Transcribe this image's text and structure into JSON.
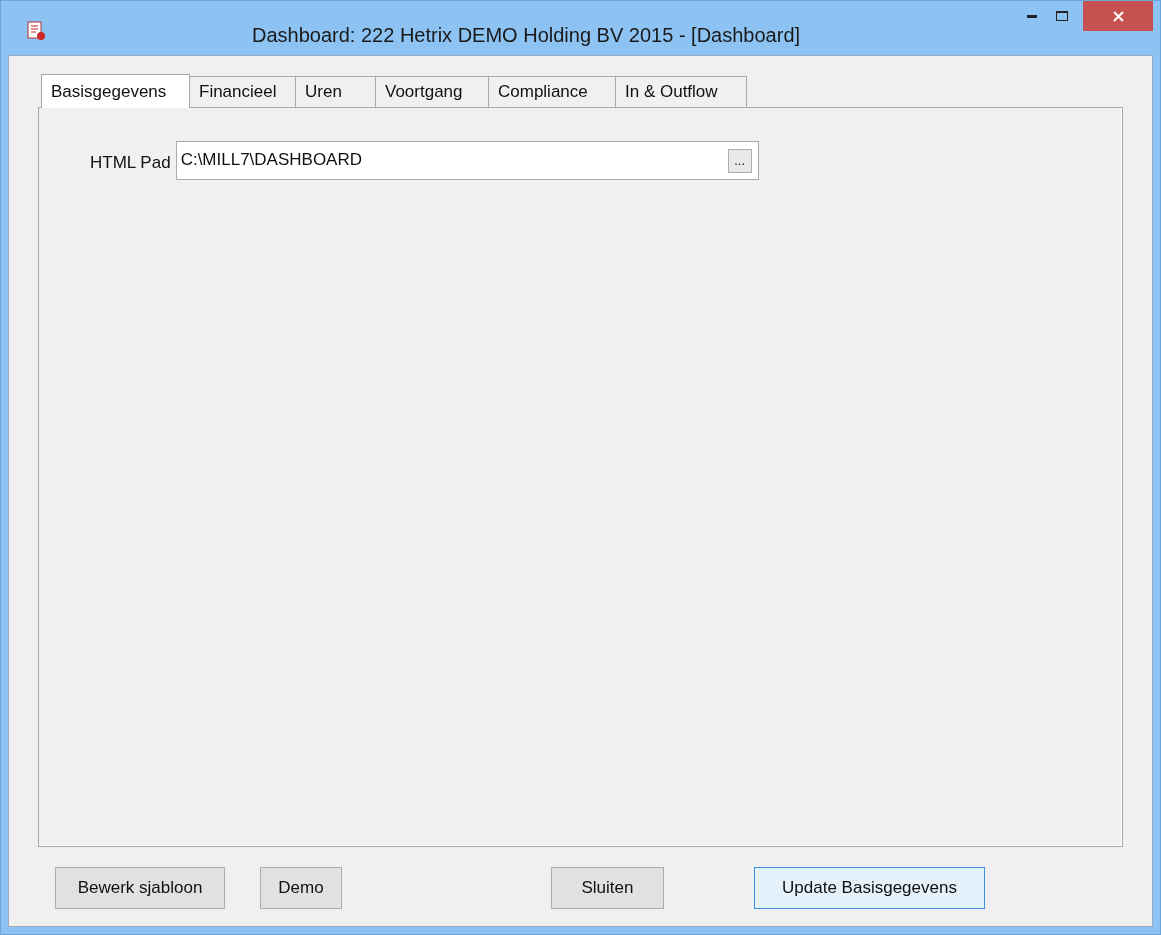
{
  "window": {
    "title": "Dashboard: 222 Hetrix DEMO Holding BV 2015 - [Dashboard]"
  },
  "tabs": [
    {
      "label": "Basisgegevens",
      "selected": true
    },
    {
      "label": "Financieel",
      "selected": false
    },
    {
      "label": "Uren",
      "selected": false
    },
    {
      "label": "Voortgang",
      "selected": false
    },
    {
      "label": "Compliance",
      "selected": false
    },
    {
      "label": "In & Outflow",
      "selected": false
    }
  ],
  "html_path": {
    "label": "HTML Pad",
    "value": "C:\\MILL7\\DASHBOARD",
    "browse": "..."
  },
  "buttons": [
    {
      "label": "Bewerk sjabloon",
      "focused": false
    },
    {
      "label": "Demo",
      "focused": false
    },
    {
      "label": "Sluiten",
      "focused": false
    },
    {
      "label": "Update Basisgegevens",
      "focused": true
    }
  ]
}
